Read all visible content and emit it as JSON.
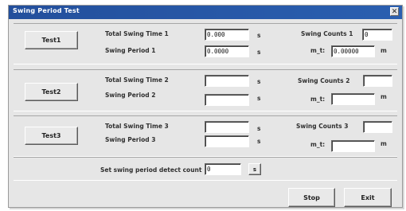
{
  "window": {
    "title": "Swing Period Test",
    "close_glyph": "✕"
  },
  "tests": [
    {
      "button": "Test1",
      "total_label": "Total Swing Time 1",
      "period_label": "Swing Period 1",
      "total_value": "0.000",
      "period_value": "0.0000",
      "total_unit": "s",
      "period_unit": "s",
      "count_label": "Swing Counts 1",
      "count_value": "0",
      "lambda_label": "m_t:",
      "lambda_value": "0.00000",
      "lambda_unit": "m"
    },
    {
      "button": "Test2",
      "total_label": "Total Swing Time 2",
      "period_label": "Swing Period 2",
      "total_value": "",
      "period_value": "",
      "total_unit": "s",
      "period_unit": "s",
      "count_label": "Swing Counts 2",
      "count_value": "",
      "lambda_label": "m_t:",
      "lambda_value": "",
      "lambda_unit": "m"
    },
    {
      "button": "Test3",
      "total_label": "Total Swing Time 3",
      "period_label": "Swing Period 3",
      "total_value": "",
      "period_value": "",
      "total_unit": "s",
      "period_unit": "s",
      "count_label": "Swing Counts 3",
      "count_value": "",
      "lambda_label": "m_t:",
      "lambda_value": "",
      "lambda_unit": "m"
    }
  ],
  "detect": {
    "label": "Set swing period detect count",
    "value": "0",
    "set_button": "s"
  },
  "footer": {
    "stop": "Stop",
    "exit": "Exit"
  }
}
